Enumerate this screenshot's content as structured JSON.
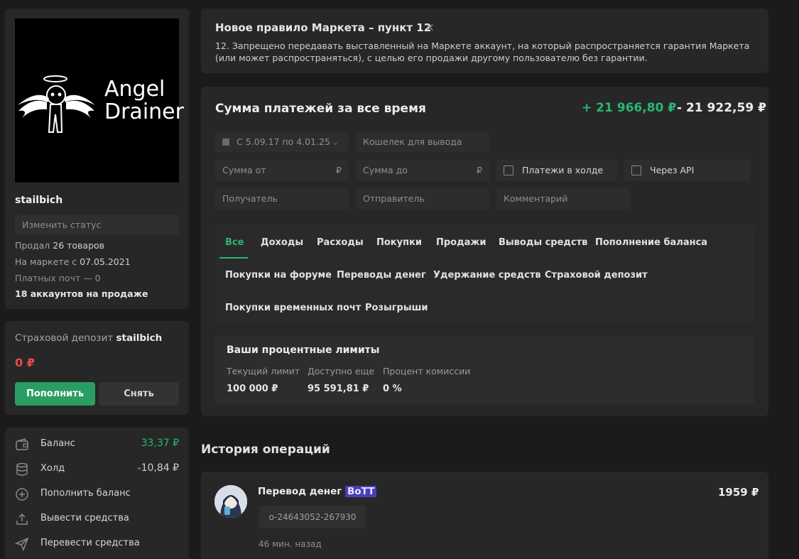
{
  "profile": {
    "avatar_text_line1": "Angel",
    "avatar_text_line2": "Drainer",
    "username": "stailbich",
    "status_placeholder": "Изменить статус",
    "sold_prefix": "Продал ",
    "sold_count": "26 товаров",
    "market_prefix": "На маркете с ",
    "market_date": "07.05.2021",
    "paid_mails": "Платных почт — 0",
    "accounts_for_sale": "18 аккаунтов на продаже"
  },
  "deposit": {
    "title_prefix": "Страховой депозит ",
    "title_user": "stailbich",
    "amount": "0 ₽",
    "topup_label": "Пополнить",
    "withdraw_label": "Снять"
  },
  "balance": {
    "items": [
      {
        "icon": "wallet-icon",
        "label": "Баланс",
        "value": "33,37 ₽",
        "value_color": "#2bb673"
      },
      {
        "icon": "database-icon",
        "label": "Холд",
        "value": "10,84 ₽",
        "value_color": "#cfcfcf",
        "has_chevron": true
      },
      {
        "icon": "plus-circle-icon",
        "label": "Пополнить баланс"
      },
      {
        "icon": "upload-icon",
        "label": "Вывести средства"
      },
      {
        "icon": "send-icon",
        "label": "Перевести средства"
      }
    ]
  },
  "notice": {
    "title": "Новое правило Маркета – пункт 12",
    "close_glyph": "✕",
    "text": "12. Запрещено передавать выставленный на Маркете аккаунт, на который распространяется гарантия Маркета (или может распространяться), с целью его продажи другому пользователю без гарантии."
  },
  "payments": {
    "title": "Сумма платежей за все время",
    "income_total": "+ 21 966,80 ₽",
    "outcome_total": "- 21 922,59 ₽",
    "filters": {
      "date_range": "С 5.09.17 по 4.01.25",
      "wallet_placeholder": "Кошелек для вывода",
      "sum_from_placeholder": "Сумма от",
      "sum_to_placeholder": "Сумма до",
      "currency_symbol": "₽",
      "hold_label": "Платежи в холде",
      "api_label": "Через API",
      "receiver_placeholder": "Получатель",
      "sender_placeholder": "Отправитель",
      "comment_placeholder": "Комментарий"
    },
    "tabs": [
      "Все",
      "Доходы",
      "Расходы",
      "Покупки",
      "Продажи",
      "Выводы средств",
      "Пополнение баланса",
      "Покупки на форуме",
      "Переводы денег",
      "Удержание средств",
      "Страховой депозит",
      "Покупки временных почт",
      "Розыгрыши"
    ],
    "active_tab": "Все",
    "limits": {
      "title": "Ваши процентные лимиты",
      "columns": [
        {
          "label": "Текущий лимит",
          "value": "100 000 ₽"
        },
        {
          "label": "Доступно еще",
          "value": "95 591,81 ₽"
        },
        {
          "label": "Процент комиссии",
          "value": "0 %"
        }
      ]
    }
  },
  "history": {
    "title": "История операций",
    "items": [
      {
        "title": "Перевод денег",
        "badge": "BoTT",
        "amount": "1959 ₽",
        "operation_id": "o-24643052-267930",
        "time": "46 мин. назад"
      }
    ]
  }
}
